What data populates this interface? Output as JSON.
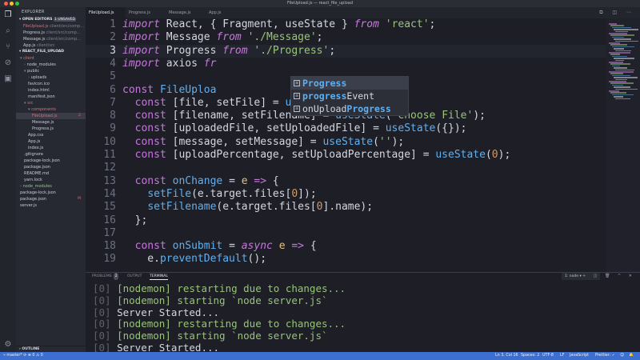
{
  "window": {
    "title": "FileUpload.js — react_file_upload"
  },
  "sidebar": {
    "header": "EXPLORER",
    "open_editors": {
      "label": "OPEN EDITORS",
      "badge": "1 UNSAVED"
    },
    "open_files": [
      {
        "name": "FileUpload.js",
        "path": "client/src/comp..."
      },
      {
        "name": "Progress.js",
        "path": "client/src/comp..."
      },
      {
        "name": "Message.js",
        "path": "client/src/comp..."
      },
      {
        "name": "App.js",
        "path": "client/src"
      }
    ],
    "project": "REACT_FILE_UPLOAD",
    "tree": [
      {
        "name": "client",
        "indent": 1,
        "twisty": "▾",
        "cls": "red"
      },
      {
        "name": "node_modules",
        "indent": 2,
        "twisty": "›",
        "cls": ""
      },
      {
        "name": "public",
        "indent": 2,
        "twisty": "▾",
        "cls": ""
      },
      {
        "name": "uploads",
        "indent": 3,
        "twisty": "›",
        "cls": ""
      },
      {
        "name": "favicon.ico",
        "indent": 3,
        "twisty": "",
        "cls": ""
      },
      {
        "name": "index.html",
        "indent": 3,
        "twisty": "",
        "cls": ""
      },
      {
        "name": "manifest.json",
        "indent": 3,
        "twisty": "",
        "cls": ""
      },
      {
        "name": "src",
        "indent": 2,
        "twisty": "▾",
        "cls": "red"
      },
      {
        "name": "components",
        "indent": 3,
        "twisty": "▾",
        "cls": "red"
      },
      {
        "name": "FileUpload.js",
        "indent": 4,
        "twisty": "",
        "cls": "red",
        "badge": "2",
        "selected": true
      },
      {
        "name": "Message.js",
        "indent": 4,
        "twisty": "",
        "cls": ""
      },
      {
        "name": "Progress.js",
        "indent": 4,
        "twisty": "",
        "cls": ""
      },
      {
        "name": "App.css",
        "indent": 3,
        "twisty": "",
        "cls": ""
      },
      {
        "name": "App.js",
        "indent": 3,
        "twisty": "",
        "cls": ""
      },
      {
        "name": "index.js",
        "indent": 3,
        "twisty": "",
        "cls": ""
      },
      {
        "name": ".gitignore",
        "indent": 2,
        "twisty": "",
        "cls": ""
      },
      {
        "name": "package-lock.json",
        "indent": 2,
        "twisty": "",
        "cls": ""
      },
      {
        "name": "package.json",
        "indent": 2,
        "twisty": "",
        "cls": ""
      },
      {
        "name": "README.md",
        "indent": 2,
        "twisty": "",
        "cls": ""
      },
      {
        "name": "yarn.lock",
        "indent": 2,
        "twisty": "",
        "cls": ""
      },
      {
        "name": "node_modules",
        "indent": 1,
        "twisty": "›",
        "cls": "green"
      },
      {
        "name": "package-lock.json",
        "indent": 1,
        "twisty": "",
        "cls": ""
      },
      {
        "name": "package.json",
        "indent": 1,
        "twisty": "",
        "cls": "",
        "badge": "M",
        "badge_cls": "red"
      },
      {
        "name": "server.js",
        "indent": 1,
        "twisty": "",
        "cls": ""
      }
    ],
    "outline": "OUTLINE"
  },
  "tabs": [
    "FileUpload.js",
    "Progress.js",
    "Message.js",
    "App.js"
  ],
  "editor": {
    "current_line": 3,
    "lines": [
      [
        [
          "kw",
          "import"
        ],
        [
          "t",
          " React, { Fragment, useState } "
        ],
        [
          "kw",
          "from"
        ],
        [
          "t",
          " "
        ],
        [
          "str",
          "'react'"
        ],
        [
          "t",
          ";"
        ]
      ],
      [
        [
          "kw",
          "import"
        ],
        [
          "t",
          " Message "
        ],
        [
          "kw",
          "from"
        ],
        [
          "t",
          " "
        ],
        [
          "str",
          "'./Message'"
        ],
        [
          "t",
          ";"
        ]
      ],
      [
        [
          "kw",
          "import"
        ],
        [
          "t",
          " Progress "
        ],
        [
          "kw",
          "from"
        ],
        [
          "t",
          " "
        ],
        [
          "str",
          "'./Progress'"
        ],
        [
          "t",
          ";"
        ]
      ],
      [
        [
          "kw",
          "import"
        ],
        [
          "t",
          " axios "
        ],
        [
          "kw",
          "fr"
        ]
      ],
      [
        [
          "t",
          ""
        ]
      ],
      [
        [
          "kwn",
          "const"
        ],
        [
          "t",
          " "
        ],
        [
          "fn",
          "FileUploa"
        ]
      ],
      [
        [
          "t",
          "  "
        ],
        [
          "kwn",
          "const"
        ],
        [
          "t",
          " [file, setFile] = "
        ],
        [
          "fn",
          "useState"
        ],
        [
          "t",
          "("
        ],
        [
          "str",
          "''"
        ],
        [
          "t",
          ");"
        ]
      ],
      [
        [
          "t",
          "  "
        ],
        [
          "kwn",
          "const"
        ],
        [
          "t",
          " [filename, setFilename] = "
        ],
        [
          "fn",
          "useState"
        ],
        [
          "t",
          "("
        ],
        [
          "str",
          "'Choose File'"
        ],
        [
          "t",
          ");"
        ]
      ],
      [
        [
          "t",
          "  "
        ],
        [
          "kwn",
          "const"
        ],
        [
          "t",
          " [uploadedFile, setUploadedFile] = "
        ],
        [
          "fn",
          "useState"
        ],
        [
          "t",
          "({});"
        ]
      ],
      [
        [
          "t",
          "  "
        ],
        [
          "kwn",
          "const"
        ],
        [
          "t",
          " [message, setMessage] = "
        ],
        [
          "fn",
          "useState"
        ],
        [
          "t",
          "("
        ],
        [
          "str",
          "''"
        ],
        [
          "t",
          ");"
        ]
      ],
      [
        [
          "t",
          "  "
        ],
        [
          "kwn",
          "const"
        ],
        [
          "t",
          " [uploadPercentage, setUploadPercentage] = "
        ],
        [
          "fn",
          "useState"
        ],
        [
          "t",
          "("
        ],
        [
          "num",
          "0"
        ],
        [
          "t",
          ");"
        ]
      ],
      [
        [
          "t",
          ""
        ]
      ],
      [
        [
          "t",
          "  "
        ],
        [
          "kwn",
          "const"
        ],
        [
          "t",
          " "
        ],
        [
          "fn",
          "onChange"
        ],
        [
          "t",
          " = "
        ],
        [
          "pr",
          "e"
        ],
        [
          "t",
          " "
        ],
        [
          "kwn",
          "=>"
        ],
        [
          "t",
          " {"
        ]
      ],
      [
        [
          "t",
          "    "
        ],
        [
          "fn",
          "setFile"
        ],
        [
          "t",
          "(e.target.files["
        ],
        [
          "num",
          "0"
        ],
        [
          "t",
          "]);"
        ]
      ],
      [
        [
          "t",
          "    "
        ],
        [
          "fn",
          "setFilename"
        ],
        [
          "t",
          "(e.target.files["
        ],
        [
          "num",
          "0"
        ],
        [
          "t",
          "].name);"
        ]
      ],
      [
        [
          "t",
          "  };"
        ]
      ],
      [
        [
          "t",
          ""
        ]
      ],
      [
        [
          "t",
          "  "
        ],
        [
          "kwn",
          "const"
        ],
        [
          "t",
          " "
        ],
        [
          "fn",
          "onSubmit"
        ],
        [
          "t",
          " = "
        ],
        [
          "kw",
          "async"
        ],
        [
          "t",
          " "
        ],
        [
          "pr",
          "e"
        ],
        [
          "t",
          " "
        ],
        [
          "kwn",
          "=>"
        ],
        [
          "t",
          " {"
        ]
      ],
      [
        [
          "t",
          "    e."
        ],
        [
          "fn",
          "preventDefault"
        ],
        [
          "t",
          "();"
        ]
      ]
    ]
  },
  "autocomplete": [
    {
      "prefix": "",
      "match": "Progress",
      "suffix": ""
    },
    {
      "prefix": "",
      "match": "progress",
      "suffix": "Event"
    },
    {
      "prefix": "onUpload",
      "match": "Progress",
      "suffix": ""
    }
  ],
  "panel": {
    "tabs": {
      "problems": "PROBLEMS",
      "problems_count": "2",
      "output": "OUTPUT",
      "terminal": "TERMINAL"
    },
    "terminal_select": "1: node",
    "terminal_lines": [
      {
        "idx": "[0]",
        "text": " [nodemon] restarting due to changes...",
        "cls": "t-green"
      },
      {
        "idx": "[0]",
        "text": " [nodemon] starting `node server.js`",
        "cls": "t-green"
      },
      {
        "idx": "[0]",
        "text": " Server Started...",
        "cls": "t-white"
      },
      {
        "idx": "[0]",
        "text": " [nodemon] restarting due to changes...",
        "cls": "t-green"
      },
      {
        "idx": "[0]",
        "text": " [nodemon] starting `node server.js`",
        "cls": "t-green"
      },
      {
        "idx": "[0]",
        "text": " Server Started...",
        "cls": "t-white"
      }
    ]
  },
  "statusbar": {
    "branch": "master*",
    "sync": "⟳",
    "errors": "⊗ 0",
    "warnings": "⚠ 0",
    "position": "Ln 3, Col 16",
    "spaces": "Spaces: 2",
    "encoding": "UTF-8",
    "eol": "LF",
    "language": "JavaScript",
    "prettier": "Prettier: ✓",
    "smiley": "☺",
    "bell": "🔔"
  },
  "colors": {
    "accent": "#3d6fd1",
    "keyword": "#c678dd",
    "string": "#98c379",
    "function": "#61afef"
  }
}
